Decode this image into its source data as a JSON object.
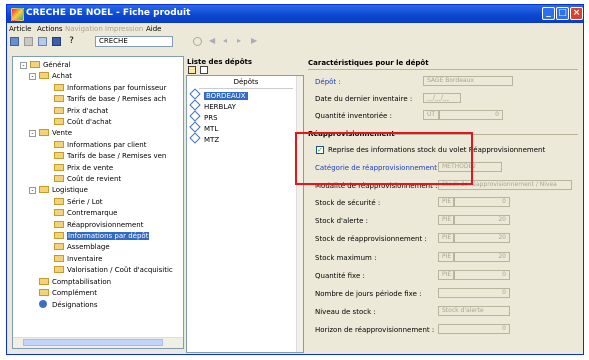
{
  "window": {
    "title": "CRECHE DE NOEL  -  Fiche produit"
  },
  "menu": {
    "items": [
      "Article",
      "Actions",
      "Navigation",
      "Impression",
      "Aide"
    ]
  },
  "toolbar": {
    "search_value": "CRECHE"
  },
  "tree": {
    "items": [
      {
        "label": "Général",
        "level": 0,
        "expander": "-"
      },
      {
        "label": "Achat",
        "level": 1,
        "expander": "-"
      },
      {
        "label": "Informations par fournisseur",
        "level": 2
      },
      {
        "label": "Tarifs de base / Remises ach",
        "level": 2
      },
      {
        "label": "Prix d'achat",
        "level": 2
      },
      {
        "label": "Coût d'achat",
        "level": 2
      },
      {
        "label": "Vente",
        "level": 1,
        "expander": "-"
      },
      {
        "label": "Informations par client",
        "level": 2
      },
      {
        "label": "Tarifs de base / Remises ven",
        "level": 2
      },
      {
        "label": "Prix de vente",
        "level": 2
      },
      {
        "label": "Coût de revient",
        "level": 2
      },
      {
        "label": "Logistique",
        "level": 1,
        "expander": "-"
      },
      {
        "label": "Série / Lot",
        "level": 2
      },
      {
        "label": "Contremarque",
        "level": 2
      },
      {
        "label": "Réapprovisionnement",
        "level": 2
      },
      {
        "label": "Informations par dépôt",
        "level": 2,
        "selected": true
      },
      {
        "label": "Assemblage",
        "level": 2
      },
      {
        "label": "Inventaire",
        "level": 2
      },
      {
        "label": "Valorisation / Coût d'acquisitic",
        "level": 2
      },
      {
        "label": "Comptabilisation",
        "level": 1
      },
      {
        "label": "Complément",
        "level": 1
      },
      {
        "label": "Désignations",
        "level": 1,
        "icon": "person-icon"
      }
    ]
  },
  "depots": {
    "title": "Liste des dépôts",
    "column_header": "Dépôts",
    "items": [
      "BORDEAUX",
      "HERBLAY",
      "PRS",
      "MTL",
      "MTZ"
    ],
    "selected": "BORDEAUX"
  },
  "characteristics": {
    "title": "Caractéristiques pour le dépôt",
    "depot_label": "Dépôt :",
    "depot_value": "SAGE Bordeaux",
    "last_inventory_label": "Date du dernier inventaire :",
    "last_inventory_value": "__/__/__",
    "qty_label": "Quantité inventoriée :",
    "qty_unit": "UT",
    "qty_value": "0"
  },
  "replenishment": {
    "title": "Réapprovisionnement",
    "checkbox_label": "Reprise des informations stock du volet Réapprovisionnement",
    "checkbox_checked": true,
    "category_label": "Catégorie de réapprovisionnement :",
    "category_value": "METHODE2",
    "mode_label": "Modalité de réapprovisionnement :",
    "mode_value": "Stock de réapprovisionnement / Nivea",
    "rows": [
      {
        "label": "Stock de sécurité :",
        "unit": "PIE",
        "value": "0"
      },
      {
        "label": "Stock d'alerte :",
        "unit": "PIE",
        "value": "20"
      },
      {
        "label": "Stock de réapprovisionnement :",
        "unit": "PIE",
        "value": "20"
      },
      {
        "label": "Stock maximum :",
        "unit": "PIE",
        "value": "20"
      },
      {
        "label": "Quantité fixe :",
        "unit": "PIE",
        "value": "0"
      },
      {
        "label": "Nombre de jours période fixe :",
        "unit": "",
        "value": "0"
      },
      {
        "label": "Niveau de stock :",
        "unit": "",
        "value": "Stock d'alerte"
      },
      {
        "label": "Horizon de réapprovisionnement :",
        "unit": "",
        "value": "0"
      }
    ]
  },
  "colors": {
    "titlebar": "#0a46d0",
    "selection": "#316ac5",
    "highlight_box": "#e8141c"
  }
}
